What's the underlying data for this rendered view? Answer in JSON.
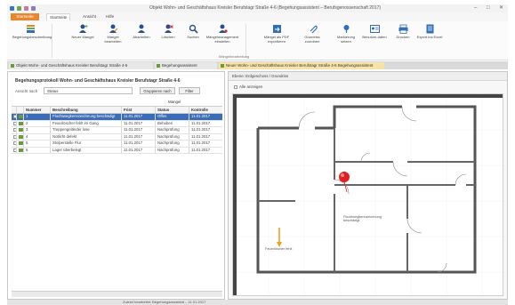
{
  "window": {
    "title": "Objekt Wohn- und Geschäftshaus Kreisler Berufstagr Straße 4-6 (Begehungsassistent – Berufsgenossenschaft 2017)",
    "controls": [
      "–",
      "□",
      "✕"
    ]
  },
  "menu": {
    "file_label": "Startseite",
    "tabs": [
      "Startseite",
      "Ansicht",
      "Hilfe"
    ],
    "active_tab": "Startseite"
  },
  "ribbon": {
    "buttons": [
      {
        "label": "Begehungsbeschreibung",
        "icon": "report-icon",
        "color": "#2f6fb5"
      },
      {
        "label": "Neuer Mangel",
        "icon": "user-add-icon",
        "color": "#2a4f8a"
      },
      {
        "label": "Mangel bearbeiten",
        "icon": "user-edit-icon",
        "color": "#2a4f8a"
      },
      {
        "label": "Abarbeiten",
        "icon": "user-check-icon",
        "color": "#2a4f8a"
      },
      {
        "label": "Löschen",
        "icon": "user-delete-icon",
        "color": "#2a4f8a"
      },
      {
        "label": "Suchen",
        "icon": "search-icon",
        "color": "#2a4f8a"
      },
      {
        "label": "Mängelmanagement einstellen",
        "icon": "user-settings-icon",
        "color": "#2a4f8a"
      },
      {
        "label": "Mängel als PDF exportieren",
        "icon": "export-icon",
        "color": "#2f6fb5"
      },
      {
        "label": "Grundriss zuordnen",
        "icon": "attach-icon",
        "color": "#2f6fb5"
      },
      {
        "label": "Markierung setzen",
        "icon": "pin-icon",
        "color": "#2f6fb5"
      },
      {
        "label": "Benutzer-daten",
        "icon": "user-data-icon",
        "color": "#2f6fb5"
      },
      {
        "label": "Drucken",
        "icon": "print-icon",
        "color": "#2f6fb5"
      },
      {
        "label": "Export ins Excel",
        "icon": "excel-icon",
        "color": "#2f6fb5"
      }
    ],
    "group_label": "Mängelbearbeitung"
  },
  "doc_tabs": [
    {
      "label": "Objekt Wohn- und Geschäftshaus Kreisler Berufstagr Straße 4-6",
      "active": false
    },
    {
      "label": "Begehungsassistent",
      "active": false
    },
    {
      "label": "Neuer Wohn- und Geschäftshaus Kreisler Berufstagr Straße 4-6 Begehungsassistent",
      "active": true
    }
  ],
  "left_panel": {
    "title": "Begehungsprotokoll Wohn- und Geschäftshaus Kreisler Berufstagr Straße 4-6",
    "filter_label": "Ansicht nach",
    "filter_value": "Status",
    "buttons": [
      "Gruppieren nach",
      "Filter"
    ],
    "group_header": "Mangel",
    "columns": [
      "Nummer",
      "Beschreibung",
      "Frist",
      "Status",
      "Kontrolle"
    ],
    "rows": [
      {
        "nr": "1",
        "beschreibung": "Fluchtwegkennzeichnung beschädigt",
        "frist": "11.01.2017",
        "status": "Offen",
        "kontrolle": "11.01.2017",
        "selected": true
      },
      {
        "nr": "2",
        "beschreibung": "Feuerlöscher fehlt im Gang",
        "frist": "11.01.2017",
        "status": "Behoben",
        "kontrolle": "11.01.2017",
        "selected": false
      },
      {
        "nr": "3",
        "beschreibung": "Treppengeländer lose",
        "frist": "11.01.2017",
        "status": "Nachprüfung",
        "kontrolle": "11.01.2017",
        "selected": false
      },
      {
        "nr": "4",
        "beschreibung": "Notlicht defekt",
        "frist": "11.01.2017",
        "status": "Nachprüfung",
        "kontrolle": "11.01.2017",
        "selected": false
      },
      {
        "nr": "5",
        "beschreibung": "Stolperstelle Flur",
        "frist": "11.01.2017",
        "status": "Nachprüfung",
        "kontrolle": "11.01.2017",
        "selected": false
      },
      {
        "nr": "6",
        "beschreibung": "Lager überbelegt",
        "frist": "11.01.2017",
        "status": "Nachprüfung",
        "kontrolle": "11.01.2017",
        "selected": false
      }
    ]
  },
  "right_panel": {
    "toolbar_text": "Ebene: Erdgeschoss / Grundriss",
    "checkbox_label": "Alle anzeigen",
    "marker_label_a": "Fluchtwegkennzeichnung beschädigt",
    "marker_label_b": "Feuerlöscher fehlt"
  },
  "status_bar": {
    "text": "Zuletzt bearbeitet: Begehungsassistent – 11.01.2017"
  },
  "colors": {
    "accent": "#e8872b",
    "selection": "#3b6cb8",
    "ribbon_icon": "#2a4f8a",
    "marker_red": "#e02020",
    "marker_orange": "#f0a020"
  }
}
